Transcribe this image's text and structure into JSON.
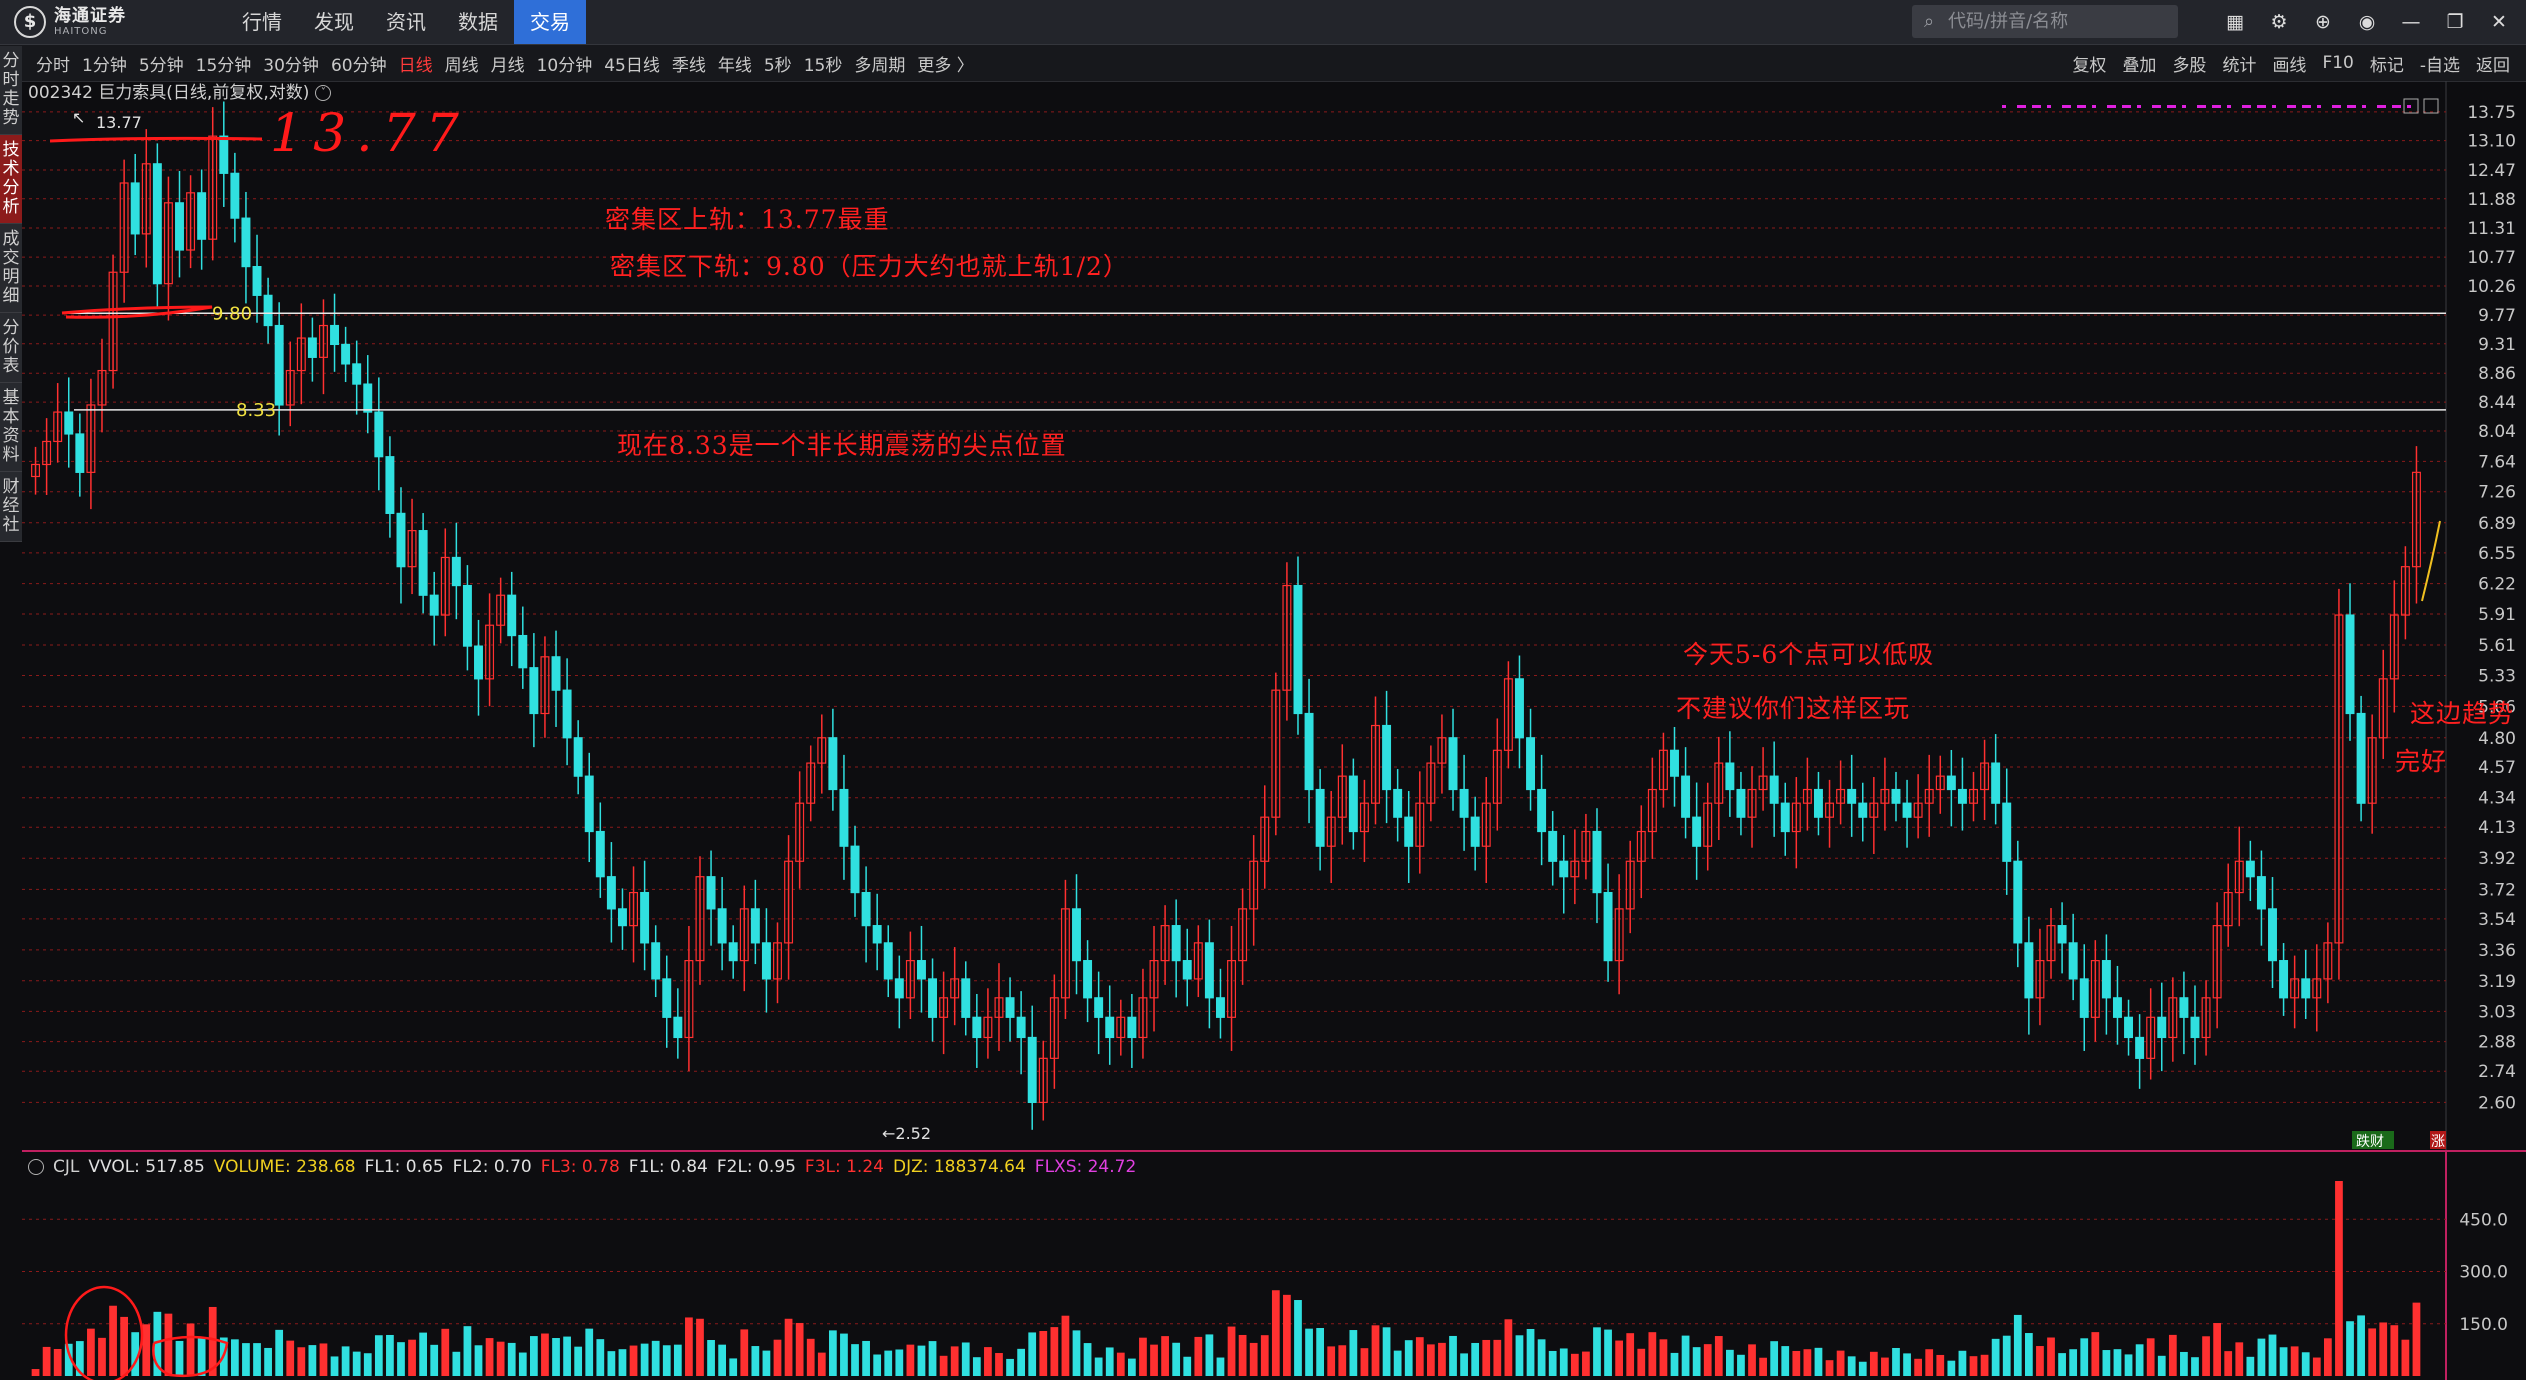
{
  "app": {
    "logo_cn": "海通证券",
    "logo_en": "HAITONG",
    "logo_mark": "$"
  },
  "nav": [
    {
      "label": "行情"
    },
    {
      "label": "发现"
    },
    {
      "label": "资讯"
    },
    {
      "label": "数据"
    },
    {
      "label": "交易",
      "active": true
    }
  ],
  "search": {
    "placeholder": "代码/拼音/名称"
  },
  "window_icons": [
    "grid-icon",
    "gear-icon",
    "globe-icon",
    "chat-icon",
    "minimize-icon",
    "restore-icon",
    "close-icon"
  ],
  "periods": [
    {
      "label": "分时"
    },
    {
      "label": "1分钟"
    },
    {
      "label": "5分钟"
    },
    {
      "label": "15分钟"
    },
    {
      "label": "30分钟"
    },
    {
      "label": "60分钟"
    },
    {
      "label": "日线",
      "active": true
    },
    {
      "label": "周线"
    },
    {
      "label": "月线"
    },
    {
      "label": "10分钟"
    },
    {
      "label": "45日线"
    },
    {
      "label": "季线"
    },
    {
      "label": "年线"
    },
    {
      "label": "5秒"
    },
    {
      "label": "15秒"
    },
    {
      "label": "多周期"
    },
    {
      "label": "更多 〉"
    }
  ],
  "tools": [
    "复权",
    "叠加",
    "多股",
    "统计",
    "画线",
    "F10",
    "标记",
    "-自选",
    "返回"
  ],
  "side_tabs": [
    {
      "label": "分时走势"
    },
    {
      "label": "技术分析",
      "active": true
    },
    {
      "label": "成交明细"
    },
    {
      "label": "分价表"
    },
    {
      "label": "基本资料"
    },
    {
      "label": "财经社"
    }
  ],
  "chart_title": "002342 巨力索具(日线,前复权,对数)",
  "price_axis": [
    "13.75",
    "13.10",
    "12.47",
    "11.88",
    "11.31",
    "10.77",
    "10.26",
    "9.77",
    "9.31",
    "8.86",
    "8.44",
    "8.04",
    "7.64",
    "7.26",
    "6.89",
    "6.55",
    "6.22",
    "5.91",
    "5.61",
    "5.33",
    "5.06",
    "4.80",
    "4.57",
    "4.34",
    "4.13",
    "3.92",
    "3.72",
    "3.54",
    "3.36",
    "3.19",
    "3.03",
    "2.88",
    "2.74",
    "2.60"
  ],
  "volume_axis": [
    "450.0",
    "300.0",
    "150.0"
  ],
  "marks": {
    "high": "13.77",
    "low": "←2.52",
    "upper": "9.80",
    "lower": "8.33",
    "high_arrow": "↖"
  },
  "handwritten": "13.77",
  "notes": {
    "upper_rail": "密集区上轨：13.77最重",
    "lower_rail": "密集区下轨：9.80（压力大约也就上轨1/2）",
    "now": "现在8.33是一个非长期震荡的尖点位置",
    "today": "今天5-6个点可以低吸",
    "advise": "不建议你们这样区玩",
    "trend1": "这边趋势",
    "trend2": "完好"
  },
  "badges": {
    "event": "跌财",
    "flag": "涨"
  },
  "indicator": [
    {
      "text": "CJL",
      "color": "#d0d0d0"
    },
    {
      "text": "VVOL: 517.85",
      "color": "#e0e0e0"
    },
    {
      "text": "VOLUME: 238.68",
      "color": "#f0d020"
    },
    {
      "text": "FL1: 0.65",
      "color": "#e0e0e0"
    },
    {
      "text": "FL2: 0.70",
      "color": "#e0e0e0"
    },
    {
      "text": "FL3: 0.78",
      "color": "#ff3030"
    },
    {
      "text": "F1L: 0.84",
      "color": "#e0e0e0"
    },
    {
      "text": "F2L: 0.95",
      "color": "#e0e0e0"
    },
    {
      "text": "F3L: 1.24",
      "color": "#ff3030"
    },
    {
      "text": "DJZ: 188374.64",
      "color": "#f0d020"
    },
    {
      "text": "FLXS: 24.72",
      "color": "#e040e0"
    }
  ],
  "colors": {
    "up": "#ff3030",
    "down": "#30e0e0",
    "grid": "#8a1a1a",
    "accent": "#2f6fd8",
    "annotation": "#ff1a1a"
  },
  "chart_data": {
    "type": "candlestick",
    "scale": "log",
    "ylim": [
      2.52,
      13.77
    ],
    "close": [
      7.6,
      7.9,
      8.3,
      8.0,
      7.5,
      8.4,
      8.9,
      10.5,
      12.2,
      11.2,
      12.6,
      10.3,
      11.8,
      10.9,
      12.0,
      11.1,
      13.2,
      12.4,
      11.5,
      10.6,
      10.1,
      9.6,
      8.4,
      8.9,
      9.4,
      9.1,
      9.6,
      9.3,
      9.0,
      8.7,
      8.3,
      7.7,
      7.0,
      6.4,
      6.8,
      6.1,
      5.9,
      6.5,
      6.2,
      5.6,
      5.3,
      5.8,
      6.1,
      5.7,
      5.4,
      5.0,
      5.5,
      5.2,
      4.8,
      4.5,
      4.1,
      3.8,
      3.6,
      3.5,
      3.7,
      3.4,
      3.2,
      3.0,
      2.9,
      3.3,
      3.8,
      3.6,
      3.4,
      3.3,
      3.6,
      3.4,
      3.2,
      3.4,
      3.9,
      4.3,
      4.6,
      4.8,
      4.4,
      4.0,
      3.7,
      3.5,
      3.4,
      3.2,
      3.1,
      3.3,
      3.2,
      3.0,
      3.1,
      3.2,
      3.0,
      2.9,
      3.0,
      3.1,
      3.0,
      2.9,
      2.6,
      2.8,
      3.1,
      3.6,
      3.3,
      3.1,
      3.0,
      2.9,
      3.0,
      2.9,
      3.1,
      3.3,
      3.5,
      3.3,
      3.2,
      3.4,
      3.1,
      3.0,
      3.3,
      3.6,
      3.9,
      4.2,
      5.2,
      6.2,
      5.0,
      4.4,
      4.0,
      4.2,
      4.5,
      4.1,
      4.3,
      4.9,
      4.4,
      4.2,
      4.0,
      4.3,
      4.6,
      4.8,
      4.4,
      4.2,
      4.0,
      4.3,
      4.7,
      5.3,
      4.8,
      4.4,
      4.1,
      3.9,
      3.8,
      3.9,
      4.1,
      3.7,
      3.3,
      3.6,
      3.9,
      4.1,
      4.4,
      4.7,
      4.5,
      4.2,
      4.0,
      4.3,
      4.6,
      4.4,
      4.2,
      4.4,
      4.5,
      4.3,
      4.1,
      4.3,
      4.4,
      4.2,
      4.3,
      4.4,
      4.3,
      4.2,
      4.3,
      4.4,
      4.3,
      4.2,
      4.3,
      4.4,
      4.5,
      4.4,
      4.3,
      4.4,
      4.6,
      4.3,
      3.9,
      3.4,
      3.1,
      3.3,
      3.5,
      3.4,
      3.2,
      3.0,
      3.3,
      3.1,
      3.0,
      2.9,
      2.8,
      3.0,
      2.9,
      3.1,
      3.0,
      2.9,
      3.1,
      3.5,
      3.7,
      3.9,
      3.8,
      3.6,
      3.3,
      3.1,
      3.2,
      3.1,
      3.2,
      3.4,
      5.9,
      5.0,
      4.3,
      4.8,
      5.3,
      5.9,
      6.4,
      7.5
    ]
  }
}
